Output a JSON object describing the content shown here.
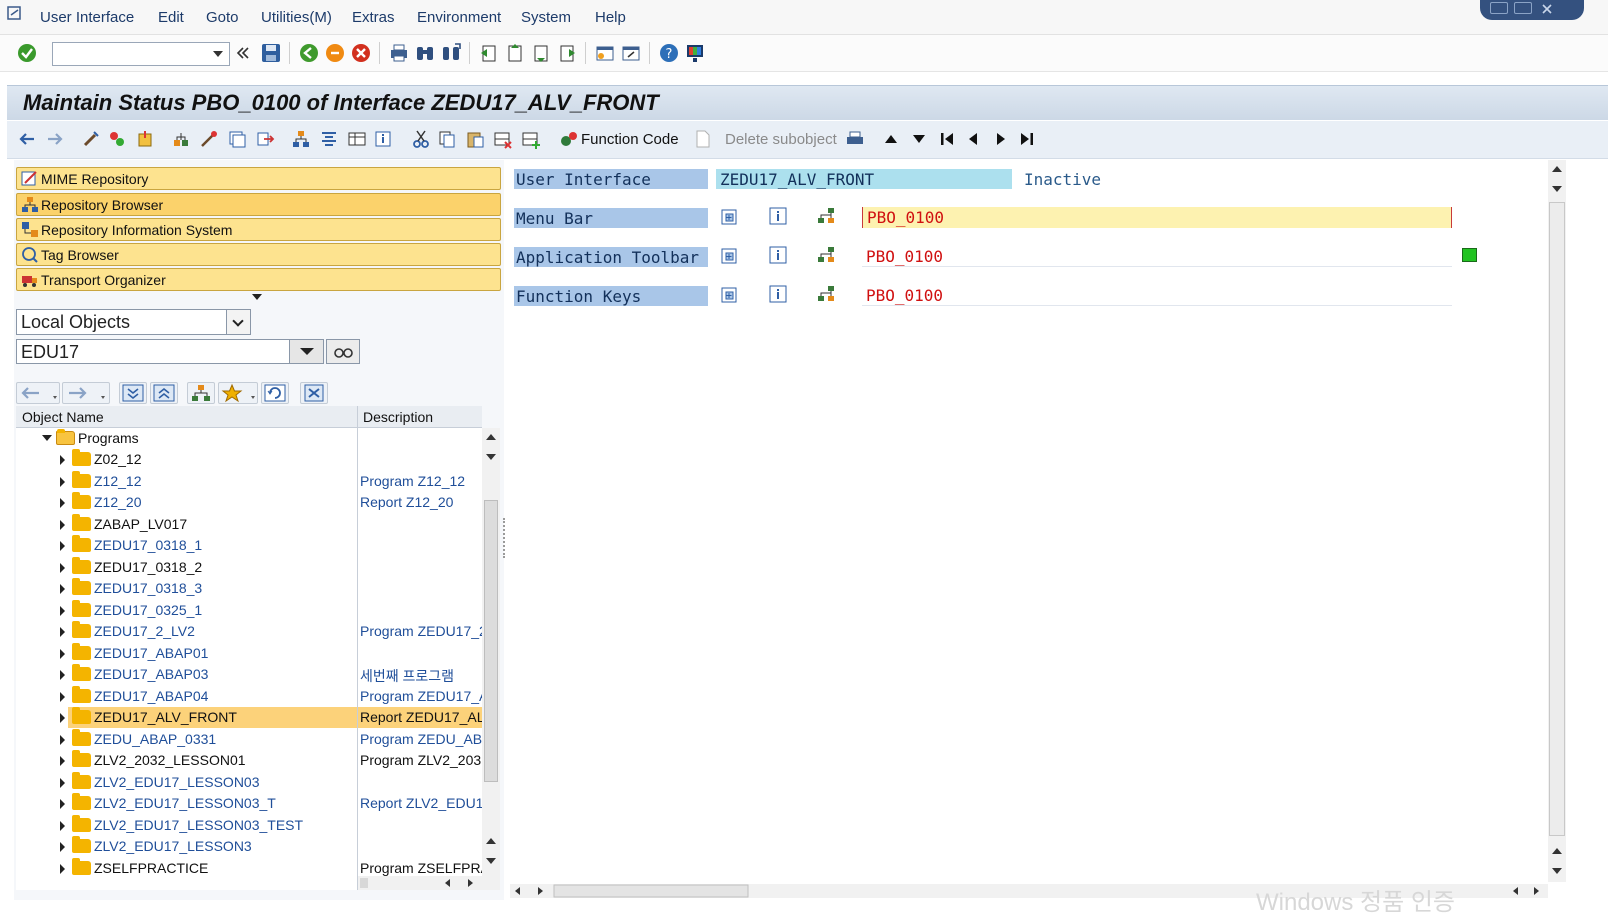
{
  "menubar": {
    "items": [
      "User Interface",
      "Edit",
      "Goto",
      "Utilities(M)",
      "Extras",
      "Environment",
      "System",
      "Help"
    ]
  },
  "window": {
    "title": "Maintain Status PBO_0100 of Interface ZEDU17_ALV_FRONT"
  },
  "app_toolbar": {
    "function_code_label": "Function Code",
    "delete_subobject_label": "Delete subobject"
  },
  "navigator": {
    "buttons": [
      "MIME Repository",
      "Repository Browser",
      "Repository Information System",
      "Tag Browser",
      "Transport Organizer"
    ],
    "object_type": "Local Objects",
    "object_name": "EDU17"
  },
  "tree": {
    "columns": [
      "Object Name",
      "Description"
    ],
    "root": "Programs",
    "rows": [
      {
        "name": "Z02_12",
        "desc": ""
      },
      {
        "name": "Z12_12",
        "desc": "Program Z12_12"
      },
      {
        "name": "Z12_20",
        "desc": "Report Z12_20"
      },
      {
        "name": "ZABAP_LV017",
        "desc": ""
      },
      {
        "name": "ZEDU17_0318_1",
        "desc": ""
      },
      {
        "name": "ZEDU17_0318_2",
        "desc": ""
      },
      {
        "name": "ZEDU17_0318_3",
        "desc": ""
      },
      {
        "name": "ZEDU17_0325_1",
        "desc": ""
      },
      {
        "name": "ZEDU17_2_LV2",
        "desc": "Program ZEDU17_2"
      },
      {
        "name": "ZEDU17_ABAP01",
        "desc": ""
      },
      {
        "name": "ZEDU17_ABAP03",
        "desc": "세번째 프로그램"
      },
      {
        "name": "ZEDU17_ABAP04",
        "desc": "Program ZEDU17_A"
      },
      {
        "name": "ZEDU17_ALV_FRONT",
        "desc": "Report ZEDU17_AL"
      },
      {
        "name": "ZEDU_ABAP_0331",
        "desc": "Program ZEDU_AB/"
      },
      {
        "name": "ZLV2_2032_LESSON01",
        "desc": "Program ZLV2_203"
      },
      {
        "name": "ZLV2_EDU17_LESSON03",
        "desc": ""
      },
      {
        "name": "ZLV2_EDU17_LESSON03_T",
        "desc": "Report ZLV2_EDU1"
      },
      {
        "name": "ZLV2_EDU17_LESSON03_TEST",
        "desc": ""
      },
      {
        "name": "ZLV2_EDU17_LESSON3",
        "desc": ""
      },
      {
        "name": "ZSELFPRACTICE",
        "desc": "Program ZSELFPRA"
      }
    ]
  },
  "status": {
    "ui_label": "User Interface",
    "ui_value": "ZEDU17_ALV_FRONT",
    "ui_state": "Inactive",
    "menu_bar_label": "Menu Bar",
    "menu_bar_value": "PBO_0100",
    "app_toolbar_label": "Application Toolbar",
    "app_toolbar_value": "PBO_0100",
    "function_keys_label": "Function Keys",
    "function_keys_value": "PBO_0100"
  },
  "watermark": "Windows 정품 인증",
  "colors": {
    "nav_button": "#fde38f",
    "label_bg": "#a9c6e8",
    "selected_row": "#fcd27a",
    "value_red": "#d01010",
    "link_blue": "#1f4e99"
  }
}
